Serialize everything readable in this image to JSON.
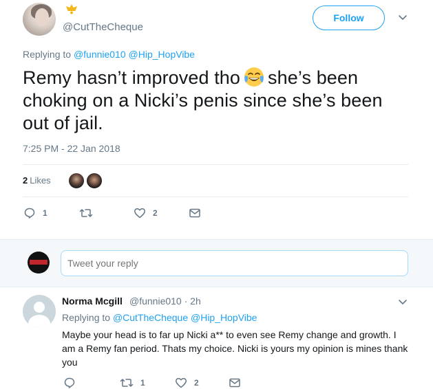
{
  "tweet": {
    "handle": "@CutTheCheque",
    "follow_label": "Follow",
    "replying_prefix": "Replying to",
    "replying_to_1": "@funnie010",
    "replying_to_2": "@Hip_HopVibe",
    "text_part1": "Remy hasn’t improved tho",
    "text_part2": "she’s been choking on a Nicki’s penis since she’s been out of jail.",
    "timestamp": "7:25 PM - 22 Jan 2018",
    "likes_number": "2",
    "likes_word": "Likes",
    "reply_count": "1",
    "retweet_count": "",
    "like_count": "2",
    "icons": [
      "crown-icon",
      "laughing-tears-emoji",
      "reply-icon",
      "retweet-icon",
      "heart-icon",
      "direct-message-icon",
      "chevron-down-icon"
    ]
  },
  "reply_box": {
    "placeholder": "Tweet your reply"
  },
  "reply": {
    "name": "Norma Mcgill",
    "handle": "@funnie010",
    "separator": "·",
    "time": "2h",
    "replying_prefix": "Replying to",
    "replying_to_1": "@CutTheCheque",
    "replying_to_2": "@Hip_HopVibe",
    "text": "Maybe your head is to far up Nicki a** to even see Remy change and growth. I am a Remy fan period. Thats my choice. Nicki is yours my opinion is mines thank you",
    "reply_count": "",
    "retweet_count": "1",
    "like_count": "2"
  },
  "colors": {
    "accent": "#1da1f2",
    "text": "#14171a",
    "muted": "#657786",
    "divider": "#e6ecf0",
    "reply_bar_bg": "#f5f8fa",
    "crown": "#f2b81b"
  }
}
